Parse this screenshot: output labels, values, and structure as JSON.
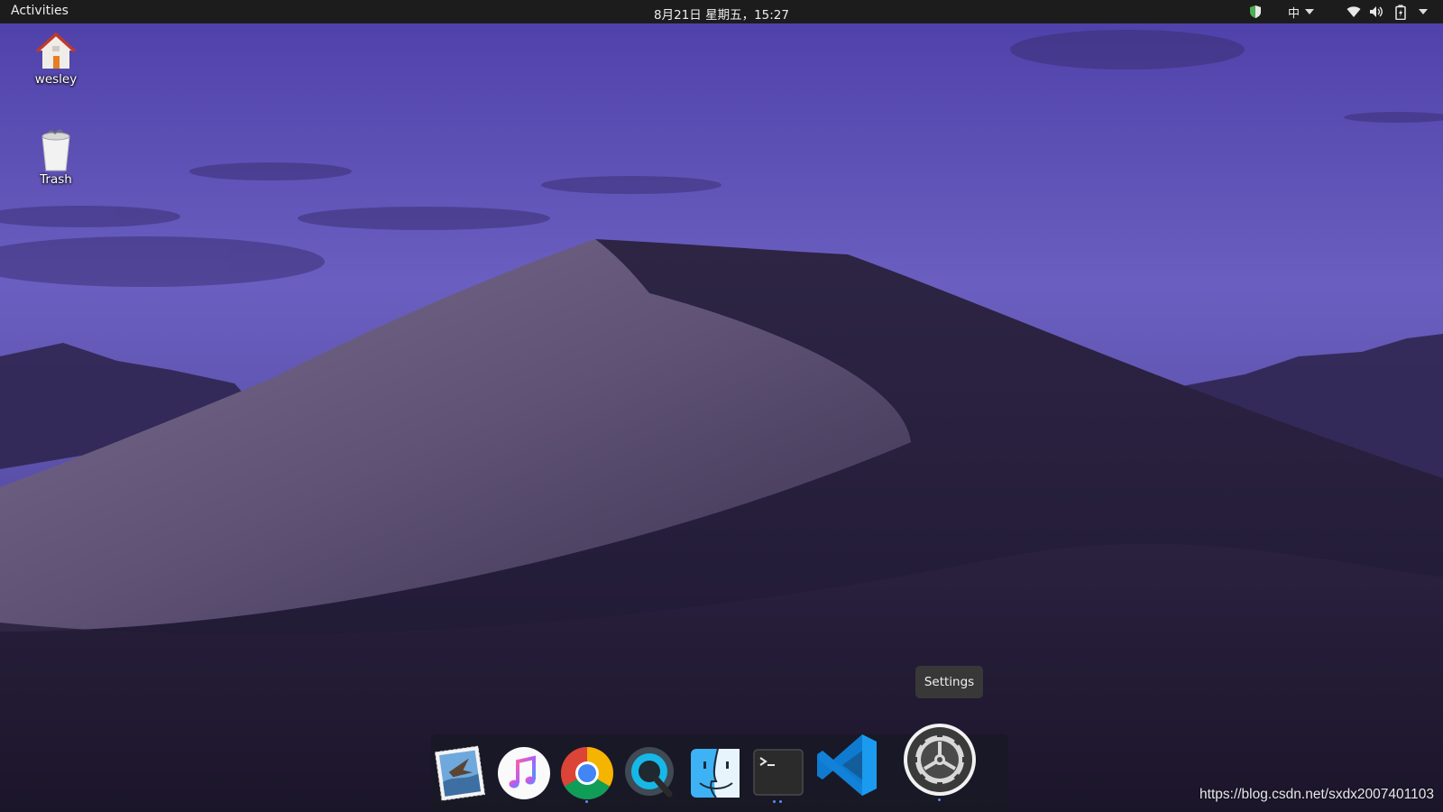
{
  "top_bar": {
    "activities_label": "Activities",
    "clock": "8月21日 星期五，15:27",
    "input_method": "中",
    "tray_icons": [
      "shield-icon",
      "input-method-dropdown",
      "wifi-icon",
      "volume-icon",
      "battery-icon",
      "system-menu-arrow"
    ]
  },
  "desktop": {
    "icons": [
      {
        "label": "wesley",
        "icon": "home-folder-icon"
      },
      {
        "label": "Trash",
        "icon": "trash-icon"
      }
    ]
  },
  "dock": {
    "apps": [
      {
        "name": "Mail",
        "icon": "mail-stamp-icon",
        "running": false
      },
      {
        "name": "Music",
        "icon": "music-note-icon",
        "running": false
      },
      {
        "name": "Google Chrome",
        "icon": "chrome-icon",
        "running": true
      },
      {
        "name": "QuickTime Player",
        "icon": "quicktime-icon",
        "running": false
      },
      {
        "name": "Finder",
        "icon": "finder-face-icon",
        "running": false
      },
      {
        "name": "Terminal",
        "icon": "terminal-icon",
        "running": true
      },
      {
        "name": "Visual Studio Code",
        "icon": "vscode-icon",
        "running": false
      },
      {
        "name": "Settings",
        "icon": "gear-icon",
        "running": true
      }
    ],
    "tooltip": "Settings"
  },
  "watermark": "https://blog.csdn.net/sxdx2007401103",
  "colors": {
    "top_bar": "#1c1c1c",
    "sky_top": "#6a5fc0",
    "sky_bottom": "#4f469a",
    "dune_dark": "#2a2140",
    "dock_bg": "#191824",
    "run_dot": "#5a8dff",
    "tooltip_bg": "#383838"
  }
}
